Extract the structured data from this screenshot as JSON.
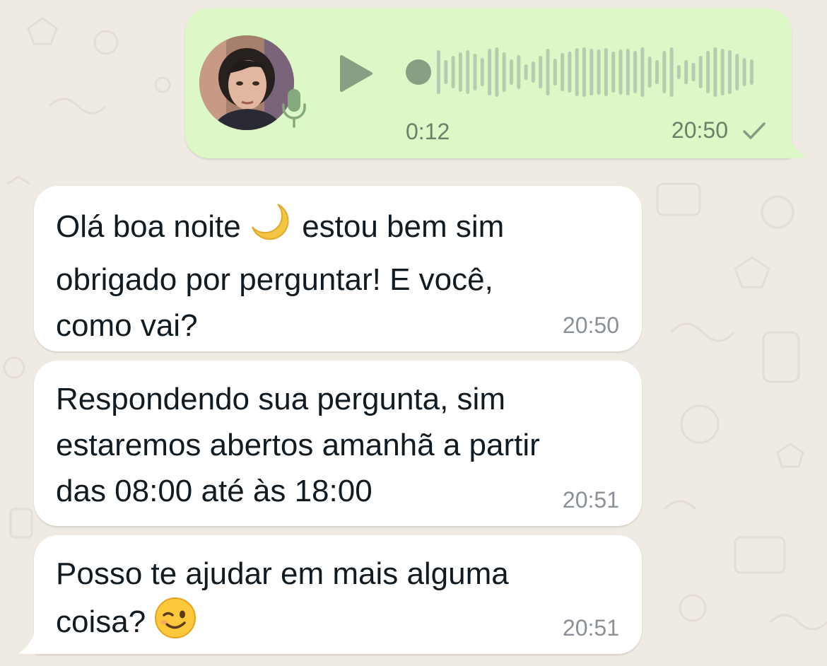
{
  "voice_message": {
    "duration": "0:12",
    "time": "20:50",
    "status": "sent",
    "icons": [
      "play-icon",
      "microphone-icon",
      "single-check-icon"
    ]
  },
  "messages": [
    {
      "before": "Olá boa noite ",
      "emoji": "crescent-moon",
      "after": " estou bem sim\nobrigado por perguntar! E você,\ncomo vai?",
      "time": "20:50"
    },
    {
      "text": "Respondendo sua pergunta, sim\nestaremos abertos amanhã a partir\ndas 08:00 até às 18:00",
      "time": "20:51"
    },
    {
      "before": "Posso te ajudar em mais alguma\ncoisa? ",
      "emoji": "winking-face",
      "after": "",
      "time": "20:51"
    }
  ],
  "colors": {
    "wallpaper": "#EFEAE2",
    "outgoing_bubble": "#DCF8C6",
    "incoming_bubble": "#FFFFFF",
    "voice_accent": "#8BAF84",
    "text": "#111B21",
    "timestamp": "#8A9098"
  }
}
